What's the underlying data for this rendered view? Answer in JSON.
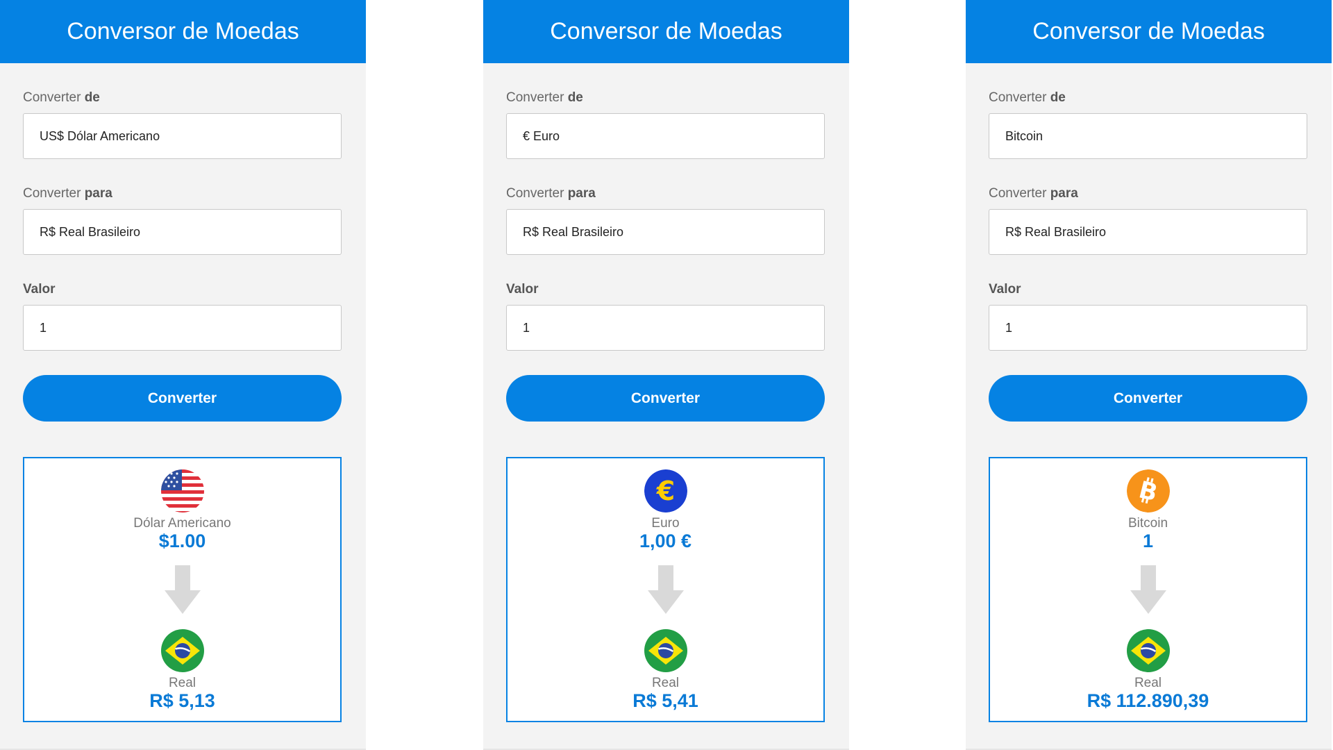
{
  "panels": [
    {
      "header": {
        "title": "Conversor de Moedas"
      },
      "from": {
        "label_prefix": "Converter",
        "label_bold": "de",
        "value": "US$ Dólar Americano"
      },
      "to": {
        "label_prefix": "Converter",
        "label_bold": "para",
        "value": "R$ Real Brasileiro"
      },
      "amount": {
        "label": "Valor",
        "value": "1"
      },
      "convert_button": "Converter",
      "result": {
        "from_icon": "us-flag-icon",
        "from_name": "Dólar Americano",
        "from_amount": "$1.00",
        "to_icon": "brazil-flag-icon",
        "to_name": "Real",
        "to_amount": "R$ 5,13"
      }
    },
    {
      "header": {
        "title": "Conversor de Moedas"
      },
      "from": {
        "label_prefix": "Converter",
        "label_bold": "de",
        "value": "€ Euro"
      },
      "to": {
        "label_prefix": "Converter",
        "label_bold": "para",
        "value": "R$ Real Brasileiro"
      },
      "amount": {
        "label": "Valor",
        "value": "1"
      },
      "convert_button": "Converter",
      "result": {
        "from_icon": "euro-coin-icon",
        "from_name": "Euro",
        "from_amount": "1,00 €",
        "to_icon": "brazil-flag-icon",
        "to_name": "Real",
        "to_amount": "R$ 5,41"
      }
    },
    {
      "header": {
        "title": "Conversor de Moedas"
      },
      "from": {
        "label_prefix": "Converter",
        "label_bold": "de",
        "value": "Bitcoin"
      },
      "to": {
        "label_prefix": "Converter",
        "label_bold": "para",
        "value": "R$ Real Brasileiro"
      },
      "amount": {
        "label": "Valor",
        "value": "1"
      },
      "convert_button": "Converter",
      "result": {
        "from_icon": "bitcoin-icon",
        "from_name": "Bitcoin",
        "from_amount": "1",
        "to_icon": "brazil-flag-icon",
        "to_name": "Real",
        "to_amount": "R$ 112.890,39"
      }
    }
  ],
  "colors": {
    "accent": "#0582e3",
    "amount_text": "#0a7ad6",
    "panel_bg": "#f3f3f3",
    "bitcoin": "#f7931a",
    "euro_blue": "#1a3fd1",
    "euro_gold": "#ffcc00",
    "brazil_green": "#229e45",
    "brazil_yellow": "#f8e509",
    "brazil_blue": "#2b49a3",
    "us_red": "#e0303a",
    "us_blue": "#2e4fa0"
  }
}
